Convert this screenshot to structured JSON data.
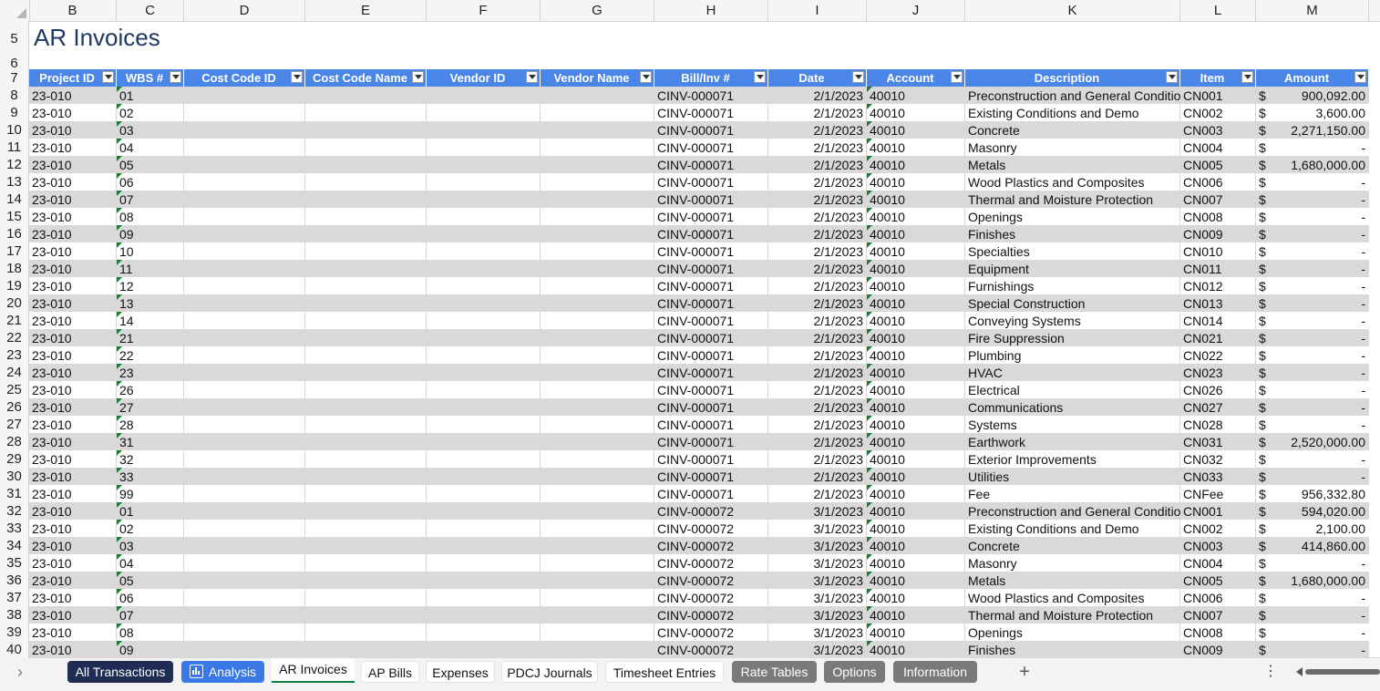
{
  "columns": [
    "B",
    "C",
    "D",
    "E",
    "F",
    "G",
    "H",
    "I",
    "J",
    "K",
    "L",
    "M"
  ],
  "title_row": "5",
  "gap_row": "6",
  "header_row": "7",
  "sheet_title": "AR Invoices",
  "headers": [
    "Project ID",
    "WBS #",
    "Cost Code ID",
    "Cost Code Name",
    "Vendor ID",
    "Vendor Name",
    "Bill/Inv #",
    "Date",
    "Account",
    "Description",
    "Item",
    "Amount"
  ],
  "rows": [
    {
      "n": "8",
      "project": "23-010",
      "wbs": "01",
      "inv": "CINV-000071",
      "date": "2/1/2023",
      "account": "40010",
      "desc": "Preconstruction and General Conditions",
      "item": "CN001",
      "cur": "$",
      "amount": "900,092.00"
    },
    {
      "n": "9",
      "project": "23-010",
      "wbs": "02",
      "inv": "CINV-000071",
      "date": "2/1/2023",
      "account": "40010",
      "desc": "Existing Conditions and Demo",
      "item": "CN002",
      "cur": "$",
      "amount": "3,600.00"
    },
    {
      "n": "10",
      "project": "23-010",
      "wbs": "03",
      "inv": "CINV-000071",
      "date": "2/1/2023",
      "account": "40010",
      "desc": "Concrete",
      "item": "CN003",
      "cur": "$",
      "amount": "2,271,150.00"
    },
    {
      "n": "11",
      "project": "23-010",
      "wbs": "04",
      "inv": "CINV-000071",
      "date": "2/1/2023",
      "account": "40010",
      "desc": "Masonry",
      "item": "CN004",
      "cur": "$",
      "amount": "-"
    },
    {
      "n": "12",
      "project": "23-010",
      "wbs": "05",
      "inv": "CINV-000071",
      "date": "2/1/2023",
      "account": "40010",
      "desc": "Metals",
      "item": "CN005",
      "cur": "$",
      "amount": "1,680,000.00"
    },
    {
      "n": "13",
      "project": "23-010",
      "wbs": "06",
      "inv": "CINV-000071",
      "date": "2/1/2023",
      "account": "40010",
      "desc": "Wood Plastics and Composites",
      "item": "CN006",
      "cur": "$",
      "amount": "-"
    },
    {
      "n": "14",
      "project": "23-010",
      "wbs": "07",
      "inv": "CINV-000071",
      "date": "2/1/2023",
      "account": "40010",
      "desc": "Thermal and Moisture Protection",
      "item": "CN007",
      "cur": "$",
      "amount": "-"
    },
    {
      "n": "15",
      "project": "23-010",
      "wbs": "08",
      "inv": "CINV-000071",
      "date": "2/1/2023",
      "account": "40010",
      "desc": "Openings",
      "item": "CN008",
      "cur": "$",
      "amount": "-"
    },
    {
      "n": "16",
      "project": "23-010",
      "wbs": "09",
      "inv": "CINV-000071",
      "date": "2/1/2023",
      "account": "40010",
      "desc": "Finishes",
      "item": "CN009",
      "cur": "$",
      "amount": "-"
    },
    {
      "n": "17",
      "project": "23-010",
      "wbs": "10",
      "inv": "CINV-000071",
      "date": "2/1/2023",
      "account": "40010",
      "desc": "Specialties",
      "item": "CN010",
      "cur": "$",
      "amount": "-"
    },
    {
      "n": "18",
      "project": "23-010",
      "wbs": "11",
      "inv": "CINV-000071",
      "date": "2/1/2023",
      "account": "40010",
      "desc": "Equipment",
      "item": "CN011",
      "cur": "$",
      "amount": "-"
    },
    {
      "n": "19",
      "project": "23-010",
      "wbs": "12",
      "inv": "CINV-000071",
      "date": "2/1/2023",
      "account": "40010",
      "desc": "Furnishings",
      "item": "CN012",
      "cur": "$",
      "amount": "-"
    },
    {
      "n": "20",
      "project": "23-010",
      "wbs": "13",
      "inv": "CINV-000071",
      "date": "2/1/2023",
      "account": "40010",
      "desc": "Special Construction",
      "item": "CN013",
      "cur": "$",
      "amount": "-"
    },
    {
      "n": "21",
      "project": "23-010",
      "wbs": "14",
      "inv": "CINV-000071",
      "date": "2/1/2023",
      "account": "40010",
      "desc": "Conveying Systems",
      "item": "CN014",
      "cur": "$",
      "amount": "-"
    },
    {
      "n": "22",
      "project": "23-010",
      "wbs": "21",
      "inv": "CINV-000071",
      "date": "2/1/2023",
      "account": "40010",
      "desc": "Fire Suppression",
      "item": "CN021",
      "cur": "$",
      "amount": "-"
    },
    {
      "n": "23",
      "project": "23-010",
      "wbs": "22",
      "inv": "CINV-000071",
      "date": "2/1/2023",
      "account": "40010",
      "desc": "Plumbing",
      "item": "CN022",
      "cur": "$",
      "amount": "-"
    },
    {
      "n": "24",
      "project": "23-010",
      "wbs": "23",
      "inv": "CINV-000071",
      "date": "2/1/2023",
      "account": "40010",
      "desc": "HVAC",
      "item": "CN023",
      "cur": "$",
      "amount": "-"
    },
    {
      "n": "25",
      "project": "23-010",
      "wbs": "26",
      "inv": "CINV-000071",
      "date": "2/1/2023",
      "account": "40010",
      "desc": "Electrical",
      "item": "CN026",
      "cur": "$",
      "amount": "-"
    },
    {
      "n": "26",
      "project": "23-010",
      "wbs": "27",
      "inv": "CINV-000071",
      "date": "2/1/2023",
      "account": "40010",
      "desc": "Communications",
      "item": "CN027",
      "cur": "$",
      "amount": "-"
    },
    {
      "n": "27",
      "project": "23-010",
      "wbs": "28",
      "inv": "CINV-000071",
      "date": "2/1/2023",
      "account": "40010",
      "desc": "Systems",
      "item": "CN028",
      "cur": "$",
      "amount": "-"
    },
    {
      "n": "28",
      "project": "23-010",
      "wbs": "31",
      "inv": "CINV-000071",
      "date": "2/1/2023",
      "account": "40010",
      "desc": "Earthwork",
      "item": "CN031",
      "cur": "$",
      "amount": "2,520,000.00"
    },
    {
      "n": "29",
      "project": "23-010",
      "wbs": "32",
      "inv": "CINV-000071",
      "date": "2/1/2023",
      "account": "40010",
      "desc": "Exterior Improvements",
      "item": "CN032",
      "cur": "$",
      "amount": "-"
    },
    {
      "n": "30",
      "project": "23-010",
      "wbs": "33",
      "inv": "CINV-000071",
      "date": "2/1/2023",
      "account": "40010",
      "desc": "Utilities",
      "item": "CN033",
      "cur": "$",
      "amount": "-"
    },
    {
      "n": "31",
      "project": "23-010",
      "wbs": "99",
      "inv": "CINV-000071",
      "date": "2/1/2023",
      "account": "40010",
      "desc": "Fee",
      "item": "CNFee",
      "cur": "$",
      "amount": "956,332.80"
    },
    {
      "n": "32",
      "project": "23-010",
      "wbs": "01",
      "inv": "CINV-000072",
      "date": "3/1/2023",
      "account": "40010",
      "desc": "Preconstruction and General Conditions",
      "item": "CN001",
      "cur": "$",
      "amount": "594,020.00"
    },
    {
      "n": "33",
      "project": "23-010",
      "wbs": "02",
      "inv": "CINV-000072",
      "date": "3/1/2023",
      "account": "40010",
      "desc": "Existing Conditions and Demo",
      "item": "CN002",
      "cur": "$",
      "amount": "2,100.00"
    },
    {
      "n": "34",
      "project": "23-010",
      "wbs": "03",
      "inv": "CINV-000072",
      "date": "3/1/2023",
      "account": "40010",
      "desc": "Concrete",
      "item": "CN003",
      "cur": "$",
      "amount": "414,860.00"
    },
    {
      "n": "35",
      "project": "23-010",
      "wbs": "04",
      "inv": "CINV-000072",
      "date": "3/1/2023",
      "account": "40010",
      "desc": "Masonry",
      "item": "CN004",
      "cur": "$",
      "amount": "-"
    },
    {
      "n": "36",
      "project": "23-010",
      "wbs": "05",
      "inv": "CINV-000072",
      "date": "3/1/2023",
      "account": "40010",
      "desc": "Metals",
      "item": "CN005",
      "cur": "$",
      "amount": "1,680,000.00"
    },
    {
      "n": "37",
      "project": "23-010",
      "wbs": "06",
      "inv": "CINV-000072",
      "date": "3/1/2023",
      "account": "40010",
      "desc": "Wood Plastics and Composites",
      "item": "CN006",
      "cur": "$",
      "amount": "-"
    },
    {
      "n": "38",
      "project": "23-010",
      "wbs": "07",
      "inv": "CINV-000072",
      "date": "3/1/2023",
      "account": "40010",
      "desc": "Thermal and Moisture Protection",
      "item": "CN007",
      "cur": "$",
      "amount": "-"
    },
    {
      "n": "39",
      "project": "23-010",
      "wbs": "08",
      "inv": "CINV-000072",
      "date": "3/1/2023",
      "account": "40010",
      "desc": "Openings",
      "item": "CN008",
      "cur": "$",
      "amount": "-"
    },
    {
      "n": "40",
      "project": "23-010",
      "wbs": "09",
      "inv": "CINV-000072",
      "date": "3/1/2023",
      "account": "40010",
      "desc": "Finishes",
      "item": "CN009",
      "cur": "$",
      "amount": "-"
    }
  ],
  "tabs": [
    {
      "label": "All Transactions",
      "icon": "",
      "color": "#1f2d54",
      "text_color": "#ffffff",
      "active": false
    },
    {
      "label": "Analysis",
      "icon": "chart-icon",
      "color": "#3b78e7",
      "text_color": "#ffffff",
      "active": false
    },
    {
      "label": "AR Invoices",
      "icon": "",
      "color": "#ffffff",
      "text_color": "#111111",
      "active": true
    },
    {
      "label": "AP Bills",
      "icon": "",
      "color": "#f3f3f3",
      "text_color": "#111111",
      "active": false
    },
    {
      "label": "Expenses",
      "icon": "",
      "color": "#f3f3f3",
      "text_color": "#111111",
      "active": false
    },
    {
      "label": "PDCJ Journals",
      "icon": "",
      "color": "#f3f3f3",
      "text_color": "#111111",
      "active": false
    },
    {
      "label": "Timesheet Entries",
      "icon": "",
      "color": "#f3f3f3",
      "text_color": "#111111",
      "active": false
    },
    {
      "label": "Rate Tables",
      "icon": "",
      "color": "#7a7a7a",
      "text_color": "#ffffff",
      "active": false
    },
    {
      "label": "Options",
      "icon": "",
      "color": "#7a7a7a",
      "text_color": "#ffffff",
      "active": false
    },
    {
      "label": "Information",
      "icon": "",
      "color": "#7a7a7a",
      "text_color": "#ffffff",
      "active": false
    }
  ],
  "add_sheet": "+",
  "more_menu": "⋮",
  "nav_arrow": "›",
  "accent_color": "#4a86e8",
  "band_color": "#d9d9d9"
}
